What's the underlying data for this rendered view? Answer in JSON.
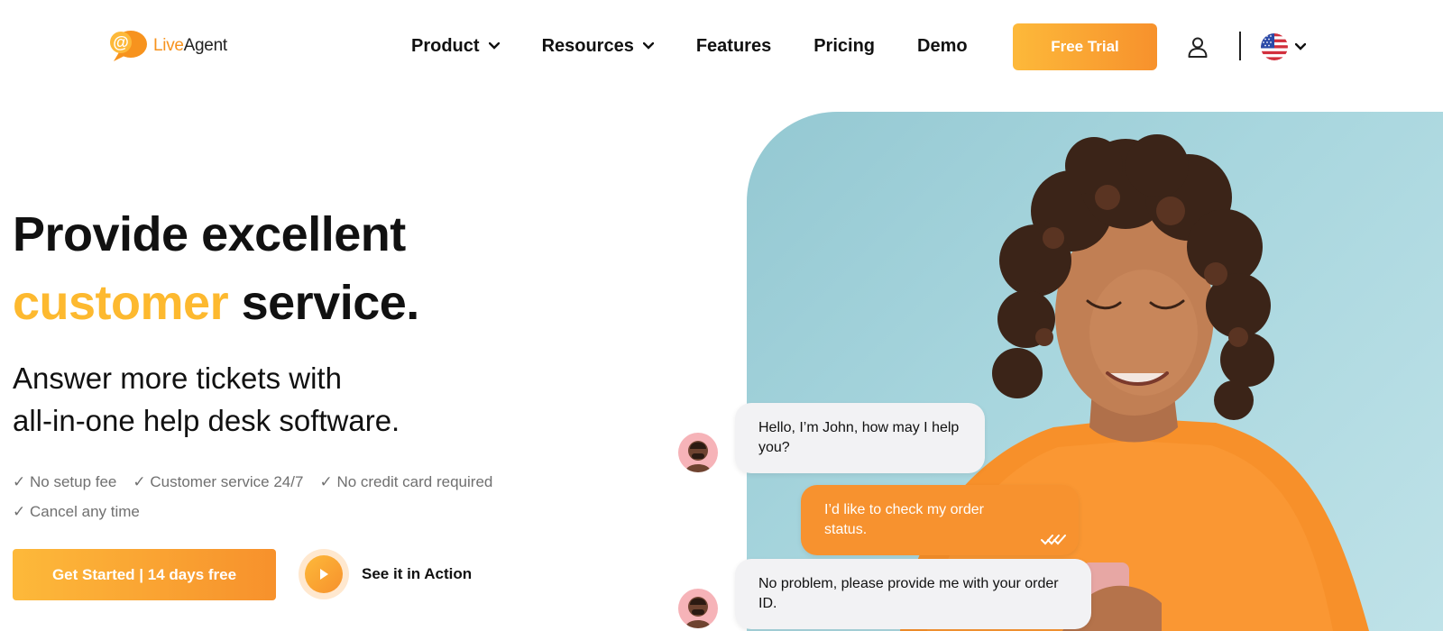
{
  "brand": {
    "logo_live": "Live",
    "logo_agent": "Agent",
    "accent": "#f7931e"
  },
  "nav": {
    "items": [
      {
        "label": "Product",
        "dropdown": true
      },
      {
        "label": "Resources",
        "dropdown": true
      },
      {
        "label": "Features",
        "dropdown": false
      },
      {
        "label": "Pricing",
        "dropdown": false
      },
      {
        "label": "Demo",
        "dropdown": false
      }
    ],
    "free_trial": "Free Trial",
    "user_icon": "user-icon",
    "language_icon": "us-flag-icon"
  },
  "hero": {
    "headline_line1": "Provide excellent",
    "headline_accent": "customer",
    "headline_rest": " service.",
    "subhead_line1": "Answer more tickets with",
    "subhead_line2": "all-in-one help desk software.",
    "checks": [
      "No setup fee",
      "Customer service 24/7",
      "No credit card required",
      "Cancel any time"
    ],
    "check_mark": "✓",
    "cta": "Get Started | 14 days free",
    "action_label": "See it in Action"
  },
  "chat": {
    "msg1": "Hello, I’m John, how may I help you?",
    "msg2": "I’d like to check my order status.",
    "msg3": "No problem, please provide me with your order ID."
  },
  "colors": {
    "orange_start": "#fdb93a",
    "orange_end": "#f7912c",
    "headline_accent": "#fdb92f",
    "hero_bg": "#a8d6de"
  }
}
